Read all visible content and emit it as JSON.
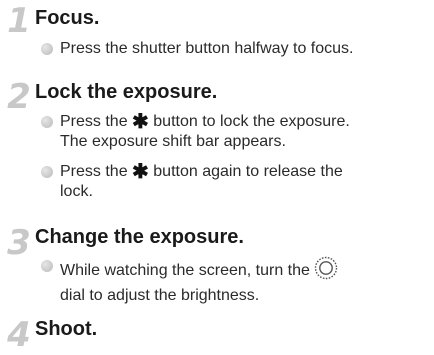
{
  "steps": [
    {
      "number": "1",
      "title": "Focus.",
      "bullets": [
        {
          "text": "Press the shutter button halfway to focus."
        }
      ]
    },
    {
      "number": "2",
      "title": "Lock the exposure.",
      "bullets": [
        {
          "before": "Press the",
          "icon": "star-asterisk-icon",
          "after": "button to lock the exposure.",
          "line2": "The exposure shift bar appears."
        },
        {
          "before": "Press the",
          "icon": "star-asterisk-icon",
          "after": "button again to release the",
          "line2": "lock."
        }
      ]
    },
    {
      "number": "3",
      "title": "Change the exposure.",
      "bullets": [
        {
          "before": "While watching the screen, turn the",
          "icon": "control-dial-icon",
          "line2": "dial to adjust the brightness."
        }
      ]
    },
    {
      "number": "4",
      "title": "Shoot."
    }
  ],
  "symbols": {
    "star": "✱"
  },
  "colors": {
    "step_number": "#c8c8c8",
    "bullet_dot": "#bcbcbc",
    "text": "#1e1e1e"
  }
}
